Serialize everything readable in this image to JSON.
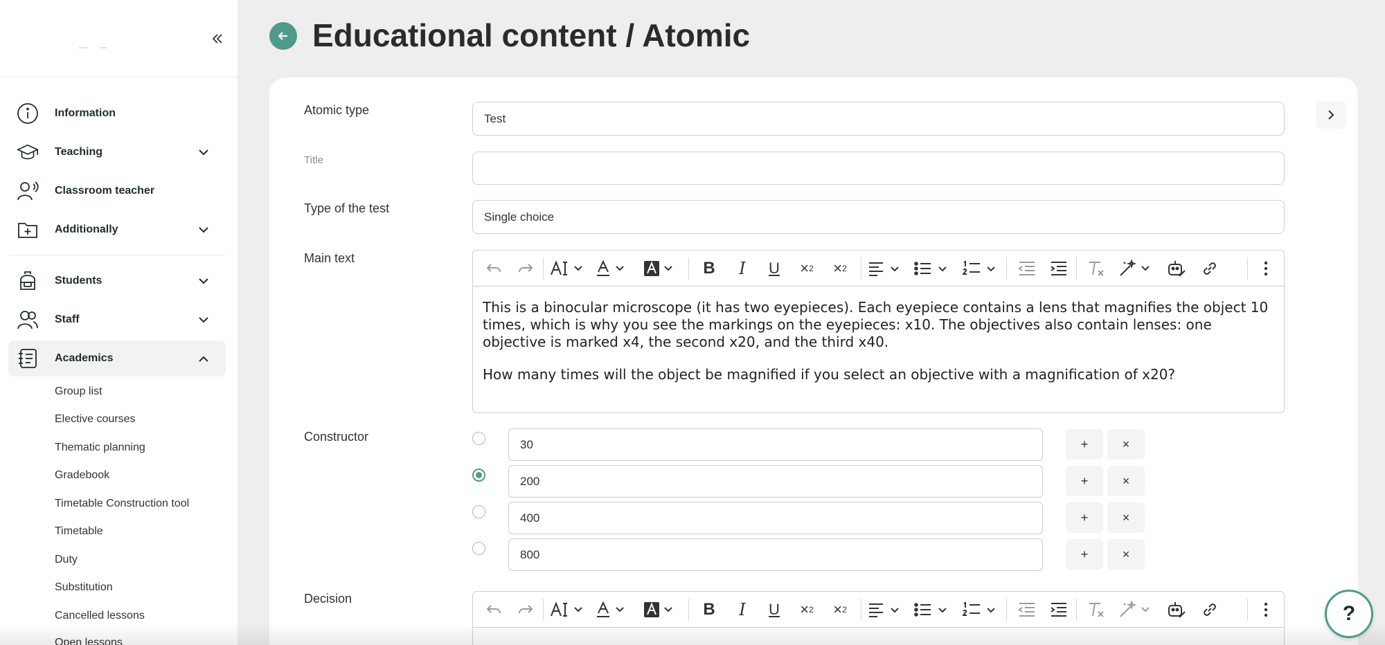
{
  "sidebar": {
    "collapse_icon": "double-chevron-left-icon",
    "items": [
      {
        "label": "Information",
        "icon": "info-circle-icon",
        "expandable": false
      },
      {
        "label": "Teaching",
        "icon": "graduation-cap-icon",
        "expandable": true
      },
      {
        "label": "Classroom teacher",
        "icon": "teacher-icon",
        "expandable": false
      },
      {
        "label": "Additionally",
        "icon": "folder-plus-icon",
        "expandable": true
      },
      {
        "label": "Students",
        "icon": "backpack-icon",
        "expandable": true
      },
      {
        "label": "Staff",
        "icon": "users-icon",
        "expandable": true
      },
      {
        "label": "Academics",
        "icon": "notebook-icon",
        "expandable": true,
        "expanded": true
      }
    ],
    "sub_items": [
      "Group list",
      "Elective courses",
      "Thematic planning",
      "Gradebook",
      "Timetable Construction tool",
      "Timetable",
      "Duty",
      "Substitution",
      "Cancelled lessons",
      "Open lessons"
    ]
  },
  "header": {
    "title": "Educational content / Atomic"
  },
  "form": {
    "atomic_type": {
      "label": "Atomic type",
      "value": "Test"
    },
    "title": {
      "label": "Title",
      "value": ""
    },
    "test_type": {
      "label": "Type of the test",
      "value": "Single choice"
    },
    "main_text": {
      "label": "Main text",
      "paragraphs": [
        "This is a binocular microscope (it has two eyepieces). Each eyepiece contains a lens that magnifies the object 10 times, which is why you see the markings on the eyepieces: x10. The objectives also contain lenses: one objective is marked x4, the second x20, and the third x40.",
        "How many times will the object be magnified if you select an objective with a magnification of x20?"
      ]
    },
    "constructor": {
      "label": "Constructor",
      "add_label": "+",
      "remove_label": "×",
      "answers": [
        {
          "value": "30",
          "selected": false
        },
        {
          "value": "200",
          "selected": true
        },
        {
          "value": "400",
          "selected": false
        },
        {
          "value": "800",
          "selected": false
        }
      ]
    },
    "decision": {
      "label": "Decision"
    }
  },
  "help": {
    "label": "?"
  },
  "colors": {
    "accent": "#4e9a8b",
    "page_bg": "#eeeeee",
    "card_bg": "#ffffff"
  }
}
